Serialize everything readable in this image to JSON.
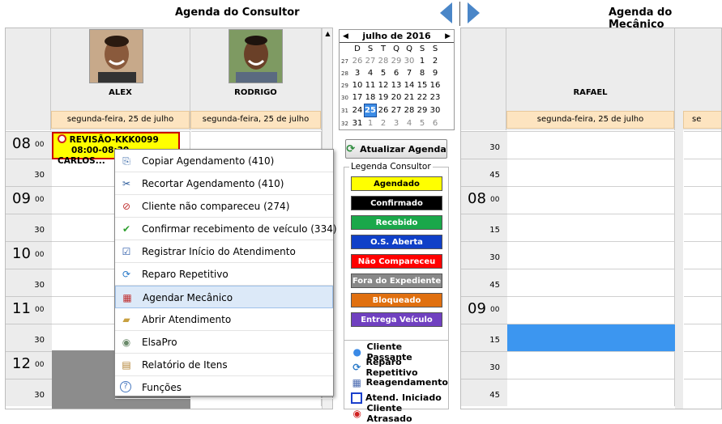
{
  "header": {
    "consultor_title": "Agenda do Consultor",
    "mecanico_title": "Agenda do Mecânico"
  },
  "consultants": [
    {
      "name": "ALEX",
      "date": "segunda-feira, 25 de julho"
    },
    {
      "name": "RODRIGO",
      "date": "segunda-feira, 25 de julho"
    }
  ],
  "mechanics": [
    {
      "name": "RAFAEL",
      "date": "segunda-feira, 25 de julho"
    },
    {
      "name": "",
      "date": "se"
    }
  ],
  "consultor_times": [
    {
      "h": "08",
      "m": "00"
    },
    {
      "m": "30"
    },
    {
      "h": "09",
      "m": "00"
    },
    {
      "m": "30"
    },
    {
      "h": "10",
      "m": "00"
    },
    {
      "m": "30"
    },
    {
      "h": "11",
      "m": "00"
    },
    {
      "m": "30"
    },
    {
      "h": "12",
      "m": "00"
    },
    {
      "m": "30"
    }
  ],
  "mecanico_times": [
    {
      "m": "30"
    },
    {
      "m": "45"
    },
    {
      "h": "08",
      "m": "00"
    },
    {
      "m": "15"
    },
    {
      "m": "30"
    },
    {
      "m": "45"
    },
    {
      "h": "09",
      "m": "00"
    },
    {
      "m": "15"
    },
    {
      "m": "30"
    },
    {
      "m": "45"
    }
  ],
  "appointment": {
    "line1": "REVISÃO-KKK0099",
    "line2": "08:00-08:30 - CARLOS..."
  },
  "calendar": {
    "month_label": "julho de 2016",
    "weekdays": [
      "D",
      "S",
      "T",
      "Q",
      "Q",
      "S",
      "S"
    ],
    "weeks": [
      {
        "wk": "27",
        "days": [
          "26",
          "27",
          "28",
          "29",
          "30",
          "1",
          "2"
        ]
      },
      {
        "wk": "28",
        "days": [
          "3",
          "4",
          "5",
          "6",
          "7",
          "8",
          "9"
        ]
      },
      {
        "wk": "29",
        "days": [
          "10",
          "11",
          "12",
          "13",
          "14",
          "15",
          "16"
        ]
      },
      {
        "wk": "30",
        "days": [
          "17",
          "18",
          "19",
          "20",
          "21",
          "22",
          "23"
        ]
      },
      {
        "wk": "31",
        "days": [
          "24",
          "25",
          "26",
          "27",
          "28",
          "29",
          "30"
        ]
      },
      {
        "wk": "32",
        "days": [
          "31",
          "1",
          "2",
          "3",
          "4",
          "5",
          "6"
        ]
      }
    ],
    "selected_day": "25"
  },
  "update_button": "Atualizar Agenda",
  "legend": {
    "title": "Legenda Consultor",
    "items": [
      {
        "label": "Agendado",
        "bg": "#ffff00",
        "fg": "#000000"
      },
      {
        "label": "Confirmado",
        "bg": "#000000",
        "fg": "#ffffff"
      },
      {
        "label": "Recebido",
        "bg": "#1aa84a",
        "fg": "#ffffff"
      },
      {
        "label": "O.S. Aberta",
        "bg": "#1040c8",
        "fg": "#ffffff"
      },
      {
        "label": "Não Compareceu",
        "bg": "#ff0000",
        "fg": "#ffffff"
      },
      {
        "label": "Fora do Expediente",
        "bg": "#888888",
        "fg": "#ffffff"
      },
      {
        "label": "Bloqueado",
        "bg": "#e07010",
        "fg": "#ffffff"
      },
      {
        "label": "Entrega Veículo",
        "bg": "#7040c0",
        "fg": "#ffffff"
      }
    ],
    "icons": [
      {
        "label": "Cliente Passante",
        "icon": "person-icon"
      },
      {
        "label": "Reparo Repetitivo",
        "icon": "repeat-icon"
      },
      {
        "label": "Reagendamento",
        "icon": "reschedule-icon"
      },
      {
        "label": "Atend. Iniciado",
        "icon": "blue-square-icon"
      },
      {
        "label": "Cliente Atrasado",
        "icon": "clock-late-icon"
      }
    ]
  },
  "context_menu": [
    {
      "label": "Copiar Agendamento (410)",
      "icon": "copy-icon"
    },
    {
      "label": "Recortar Agendamento (410)",
      "icon": "scissors-icon"
    },
    {
      "label": "Cliente não compareceu (274)",
      "icon": "no-show-icon"
    },
    {
      "label": "Confirmar recebimento de veículo (334)",
      "icon": "check-icon"
    },
    {
      "label": "Registrar Início do Atendimento",
      "icon": "checkbox-icon"
    },
    {
      "label": "Reparo Repetitivo",
      "icon": "repeat-icon"
    },
    {
      "label": "Agendar Mecânico",
      "icon": "calendar-icon"
    },
    {
      "label": "Abrir Atendimento",
      "icon": "folder-icon"
    },
    {
      "label": "ElsaPro",
      "icon": "elsapro-icon"
    },
    {
      "label": "Relatório de Itens",
      "icon": "report-icon"
    },
    {
      "label": "Funções",
      "icon": "help-icon"
    }
  ]
}
